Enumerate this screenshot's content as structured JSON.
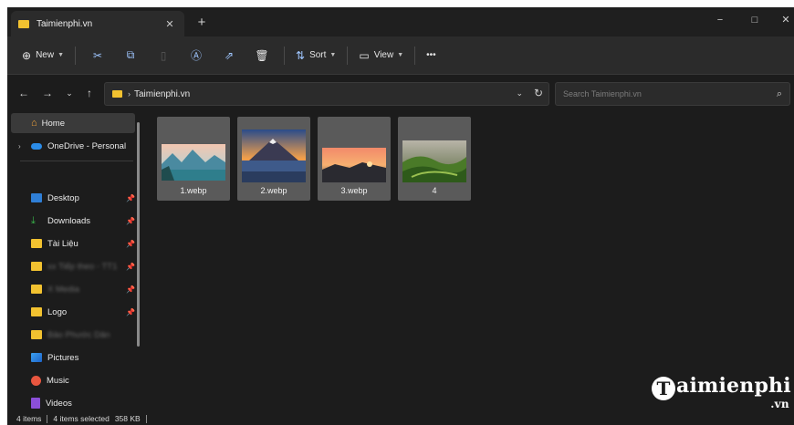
{
  "tab": {
    "title": "Taimienphi.vn",
    "close": "✕",
    "new": "+"
  },
  "window_controls": {
    "minimize": "−",
    "maximize": "□",
    "close": "✕"
  },
  "command_bar": {
    "new_label": "New",
    "sort_label": "Sort",
    "view_label": "View",
    "more_label": "•••",
    "icons": [
      "cut-icon",
      "copy-icon",
      "paste-icon",
      "rename-icon",
      "share-icon",
      "delete-icon"
    ]
  },
  "address": {
    "crumb": "Taimienphi.vn",
    "search_placeholder": "Search Taimienphi.vn"
  },
  "sidebar": {
    "home": "Home",
    "onedrive": "OneDrive - Personal",
    "items": [
      {
        "label": "Desktop",
        "pinned": true
      },
      {
        "label": "Downloads",
        "pinned": true
      },
      {
        "label": "Tài Liệu",
        "pinned": true
      },
      {
        "label": "xx Tiếp theo - TT1",
        "pinned": true
      },
      {
        "label": "X Media",
        "pinned": true
      },
      {
        "label": "Logo",
        "pinned": true
      },
      {
        "label": "Bảo Phước Dân",
        "pinned": false
      },
      {
        "label": "Pictures",
        "pinned": false
      },
      {
        "label": "Music",
        "pinned": false
      },
      {
        "label": "Videos",
        "pinned": false
      }
    ]
  },
  "files": [
    {
      "name": "1.webp",
      "scene": "lake-mountains"
    },
    {
      "name": "2.webp",
      "scene": "volcano-sunset"
    },
    {
      "name": "3.webp",
      "scene": "sunset-sea"
    },
    {
      "name": "4",
      "scene": "green-hills"
    }
  ],
  "status": {
    "items": "4 items",
    "selected": "4 items selected",
    "size": "358 KB"
  },
  "watermark": {
    "brand": "aimienphi",
    "brand_initial": "T",
    "suffix": ".vn"
  }
}
